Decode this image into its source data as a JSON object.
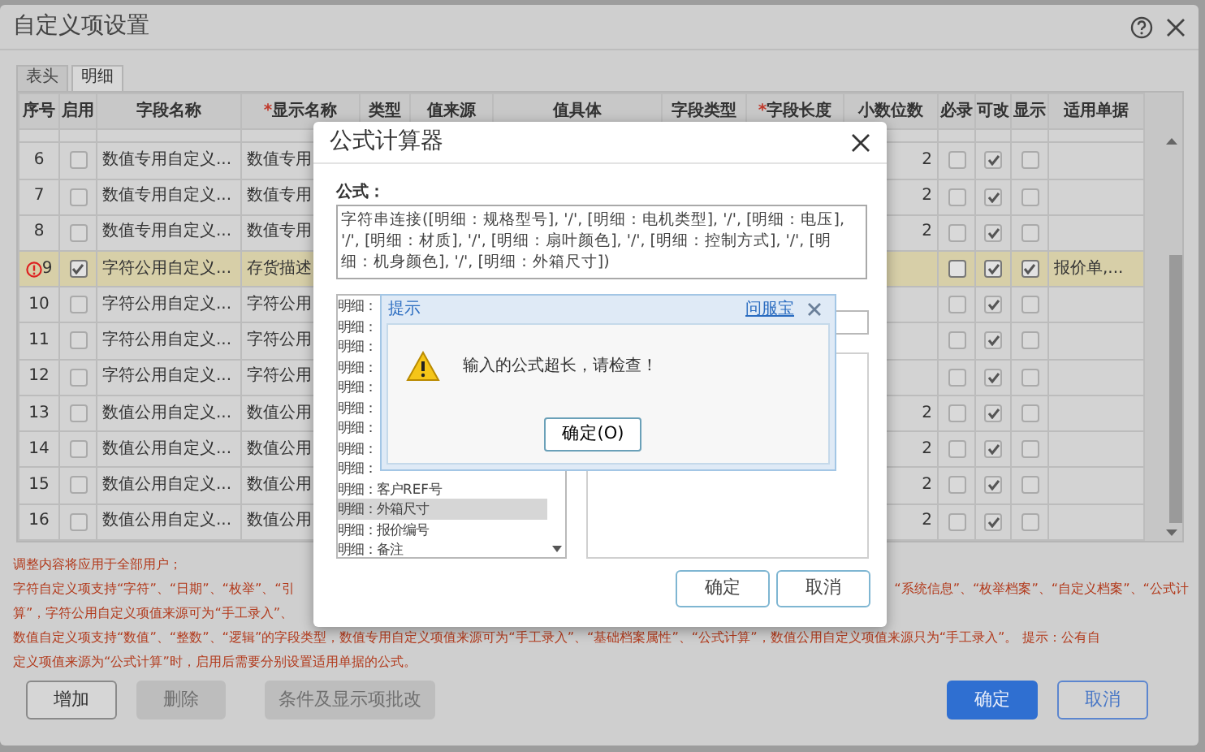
{
  "window": {
    "title": "自定义项设置"
  },
  "tabs": [
    {
      "label": "表头",
      "selected": false
    },
    {
      "label": "明细",
      "selected": true
    }
  ],
  "table": {
    "columns": [
      {
        "label": "序号"
      },
      {
        "label": "启用"
      },
      {
        "label": "字段名称"
      },
      {
        "label": "显示名称",
        "required_mark": "*"
      },
      {
        "label": "类型"
      },
      {
        "label": "值来源"
      },
      {
        "label": "值具体"
      },
      {
        "label": "字段类型"
      },
      {
        "label": "字段长度",
        "required_mark": "*"
      },
      {
        "label": "小数位数"
      },
      {
        "label": "必录"
      },
      {
        "label": "可改"
      },
      {
        "label": "显示"
      },
      {
        "label": "适用单据"
      }
    ],
    "rows": [
      {
        "number": "6",
        "error": false,
        "selected": false,
        "enabled": false,
        "field_name": "数值专用自定义...",
        "display_name": "数值专用",
        "decimals": "2",
        "required": false,
        "editable": true,
        "shown": false
      },
      {
        "number": "7",
        "error": false,
        "selected": false,
        "enabled": false,
        "field_name": "数值专用自定义...",
        "display_name": "数值专用",
        "decimals": "2",
        "required": false,
        "editable": true,
        "shown": false
      },
      {
        "number": "8",
        "error": false,
        "selected": false,
        "enabled": false,
        "field_name": "数值专用自定义...",
        "display_name": "数值专用",
        "decimals": "2",
        "required": false,
        "editable": true,
        "shown": false
      },
      {
        "number": "9",
        "error": true,
        "selected": true,
        "enabled": true,
        "field_name": "字符公用自定义...",
        "display_name": "存货描述",
        "required": false,
        "editable": true,
        "shown": true,
        "documents": "报价单,..."
      },
      {
        "number": "10",
        "error": false,
        "selected": false,
        "enabled": false,
        "field_name": "字符公用自定义...",
        "display_name": "字符公用",
        "required": false,
        "editable": true,
        "shown": false
      },
      {
        "number": "11",
        "error": false,
        "selected": false,
        "enabled": false,
        "field_name": "字符公用自定义...",
        "display_name": "字符公用",
        "required": false,
        "editable": true,
        "shown": false
      },
      {
        "number": "12",
        "error": false,
        "selected": false,
        "enabled": false,
        "field_name": "字符公用自定义...",
        "display_name": "字符公用",
        "required": false,
        "editable": true,
        "shown": false
      },
      {
        "number": "13",
        "error": false,
        "selected": false,
        "enabled": false,
        "field_name": "数值公用自定义...",
        "display_name": "数值公用",
        "decimals": "2",
        "required": false,
        "editable": true,
        "shown": false
      },
      {
        "number": "14",
        "error": false,
        "selected": false,
        "enabled": false,
        "field_name": "数值公用自定义...",
        "display_name": "数值公用",
        "decimals": "2",
        "required": false,
        "editable": true,
        "shown": false
      },
      {
        "number": "15",
        "error": false,
        "selected": false,
        "enabled": false,
        "field_name": "数值公用自定义...",
        "display_name": "数值公用",
        "decimals": "2",
        "required": false,
        "editable": true,
        "shown": false
      },
      {
        "number": "16",
        "error": false,
        "selected": false,
        "enabled": false,
        "field_name": "数值公用自定义...",
        "display_name": "数值公用",
        "decimals": "2",
        "required": false,
        "editable": true,
        "shown": false
      }
    ]
  },
  "notes": [
    {
      "segments": [
        "调整内容将应用于全部用户；"
      ]
    },
    {
      "segments": [
        "字符自定义项支持“字符”、“日期”、“枚举”、“引",
        "“系统信息”、“枚举档案”、“自定义档案”、“公式计"
      ]
    },
    {
      "segments": [
        "算”，字符公用自定义项值来源可为“手工录入”、"
      ]
    },
    {
      "segments": [
        "数值自定义项支持“数值”、“整数”、“逻辑”的字段类型，数值专用自定义项值来源可为“手工录入”、“基础档案属性”、“公式计算”，数值公用自定义项值来源只为“手工录入”。 提示：公有自"
      ]
    },
    {
      "segments": [
        "定义项值来源为“公式计算”时，启用后需要分别设置适用单据的公式。"
      ]
    }
  ],
  "actions": [
    {
      "label": "增加",
      "disabled": false
    },
    {
      "label": "删除",
      "disabled": true
    },
    {
      "label": "条件及显示项批改",
      "disabled": true
    }
  ],
  "footer_buttons": [
    {
      "label": "确定",
      "primary": true
    },
    {
      "label": "取消",
      "primary": false
    }
  ],
  "formula_dialog": {
    "title": "公式计算器",
    "formula_label": "公式：",
    "formula": "字符串连接([明细：规格型号], '/', [明细：电机类型], '/', [明细：电压], '/', [明细：材质], '/', [明细：扇叶颜色], '/', [明细：控制方式], '/', [明细：机身颜色], '/', [明细：外箱尺寸])",
    "fields": [
      {
        "label": "明细：",
        "selected": false
      },
      {
        "label": "明细：",
        "selected": false
      },
      {
        "label": "明细：",
        "selected": false
      },
      {
        "label": "明细：",
        "selected": false
      },
      {
        "label": "明细：",
        "selected": false
      },
      {
        "label": "明细：",
        "selected": false
      },
      {
        "label": "明细：",
        "selected": false
      },
      {
        "label": "明细：",
        "selected": false
      },
      {
        "label": "明细：",
        "selected": false
      },
      {
        "label": "明细：客户REF号",
        "selected": false
      },
      {
        "label": "明细：外箱尺寸",
        "selected": true
      },
      {
        "label": "明细：报价编号",
        "selected": false
      },
      {
        "label": "明细：备注",
        "selected": false
      }
    ],
    "buttons": [
      "确定",
      "取消"
    ]
  },
  "alert": {
    "title": "提示",
    "help_link": "问服宝",
    "message": "输入的公式超长，请检查！",
    "button": "确定(O)"
  }
}
